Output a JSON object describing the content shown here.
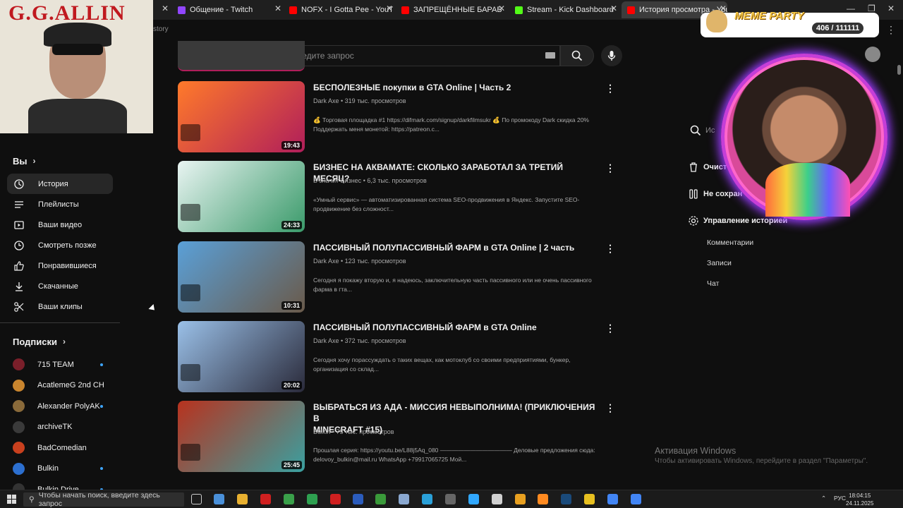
{
  "browser": {
    "tabs": [
      {
        "label": "Общение - Twitch",
        "fav": "#9146ff"
      },
      {
        "label": "NOFX - I Gotta Pee - YouTube",
        "fav": "#ff0000"
      },
      {
        "label": "ЗАПРЕЩЁННЫЕ БАРАБАНЩИ",
        "fav": "#ff0000"
      },
      {
        "label": "Stream - Kick Dashboard",
        "fav": "#53fc18"
      },
      {
        "label": "История просмотра - YouTube",
        "fav": "#ff0000"
      }
    ],
    "url_fragment": "story"
  },
  "webcam_left": {
    "title": "G.G.ALLIN"
  },
  "search": {
    "placeholder": "Введите запрос"
  },
  "sidebar": {
    "you_label": "Вы",
    "items": [
      {
        "label": "История",
        "icon": "history-icon",
        "active": true
      },
      {
        "label": "Плейлисты",
        "icon": "playlists-icon"
      },
      {
        "label": "Ваши видео",
        "icon": "your-videos-icon"
      },
      {
        "label": "Смотреть позже",
        "icon": "watch-later-icon"
      },
      {
        "label": "Понравившиеся",
        "icon": "like-icon"
      },
      {
        "label": "Скачанные",
        "icon": "download-icon"
      },
      {
        "label": "Ваши клипы",
        "icon": "scissors-icon"
      }
    ],
    "subs_label": "Подписки",
    "subscriptions": [
      {
        "label": "715 TEAM",
        "color": "#7a1f2a",
        "dot": true
      },
      {
        "label": "AcatlemeG 2nd CH",
        "color": "#c9852e",
        "dot": false
      },
      {
        "label": "Alexander PolyAK",
        "color": "#8a6a3a",
        "dot": true
      },
      {
        "label": "archiveTK",
        "color": "#3a3a3a",
        "dot": false
      },
      {
        "label": "BadComedian",
        "color": "#c8401e",
        "dot": false
      },
      {
        "label": "Bulkin",
        "color": "#2c6fcf",
        "dot": true
      },
      {
        "label": "Bulkin Drive",
        "color": "#333333",
        "dot": true
      }
    ]
  },
  "videos": [
    {
      "title": "БЕСПОЛЕЗНЫЕ покупки в GTA Online | Часть 2",
      "title2": "",
      "channel": "Dark Axe",
      "views": "319 тыс. просмотров",
      "desc1": "💰 Торговая площадка #1 https://difmark.com/signup/darkfilmsukr 💰 По промокоду Dark скидка 20%",
      "desc2": "Поддержать меня монетой: https://patreon.c...",
      "duration": "19:43",
      "thumb_colors": [
        "#ff7a2a",
        "#b01e5a"
      ]
    },
    {
      "title": "БИЗНЕС НА АКВАМАТЕ: СКОЛЬКО ЗАРАБОТАЛ ЗА ТРЕТИЙ МЕСЯЦ?",
      "title2": "",
      "channel": "Б значит Бизнес",
      "views": "6,3 тыс. просмотров",
      "desc1": "«Умный сервис» — автоматизированная система SEO-продвижения в Яндекс. Запустите SEO-",
      "desc2": "продвижение без сложност...",
      "duration": "24:33",
      "thumb_colors": [
        "#e9f4f2",
        "#3a9a6a"
      ]
    },
    {
      "title": "ПАССИВНЫЙ ПОЛУПАССИВНЫЙ ФАРМ в GTA Online | 2 часть",
      "title2": "",
      "channel": "Dark Axe",
      "views": "123 тыс. просмотров",
      "desc1": "Сегодня я покажу вторую и, я надеюсь, заключительную часть пассивного или не очень пассивного",
      "desc2": "фарма в гта...",
      "duration": "10:31",
      "thumb_colors": [
        "#5aa0d8",
        "#6a5a4a"
      ]
    },
    {
      "title": "ПАССИВНЫЙ ПОЛУПАССИВНЫЙ ФАРМ в GTA Online",
      "title2": "",
      "channel": "Dark Axe",
      "views": "372 тыс. просмотров",
      "desc1": "Сегодня хочу порассуждать о таких вещах, как мотоклуб со своими предприятиями, бункер,",
      "desc2": "организация со склад...",
      "duration": "20:02",
      "thumb_colors": [
        "#9ac0e8",
        "#2a2a3a"
      ]
    },
    {
      "title": "ВЫБРАТЬСЯ ИЗ АДА - МИССИЯ НЕВЫПОЛНИМА! (ПРИКЛЮЧЕНИЯ В",
      "title2": "MINECRAFT #15)",
      "channel": "Bulkin",
      "views": "75 тыс. просмотров",
      "desc1": "Прошлая серия: https://youtu.be/L88j5Aq_080 ———————————— Деловые предложения сюда:",
      "desc2": "delovoy_bulkin@mail.ru WhatsApp +79917065725 Мой...",
      "duration": "25:45",
      "thumb_colors": [
        "#b8321e",
        "#3aa0a0"
      ]
    }
  ],
  "right_panel": {
    "search_placeholder": "Ис",
    "clear": "Очист",
    "pause": "Не сохран",
    "manage": "Управление историей",
    "subs": [
      "Комментарии",
      "Записи",
      "Чат"
    ]
  },
  "overlay": {
    "title": "MEME PARTY",
    "count": "406 / 111111"
  },
  "activation": {
    "line1": "Активация Windows",
    "line2": "Чтобы активировать Windows, перейдите в раздел \"Параметры\"."
  },
  "taskbar": {
    "search": "Чтобы начать поиск, введите здесь запрос",
    "lang": "РУС",
    "time": "18:04:15",
    "date": "24.11.2025",
    "apps": [
      "#4a90d9",
      "#e8b030",
      "#d02020",
      "#3aa04a",
      "#2ea050",
      "#d02020",
      "#2b5cbc",
      "#3a9a3a",
      "#8aa8d0",
      "#2aa0d8",
      "#666666",
      "#31a8ff",
      "#d0d0d0",
      "#e8a020",
      "#ff8a20",
      "#1a4a7a",
      "#e8c020",
      "#4285f4",
      "#4285f4"
    ]
  }
}
